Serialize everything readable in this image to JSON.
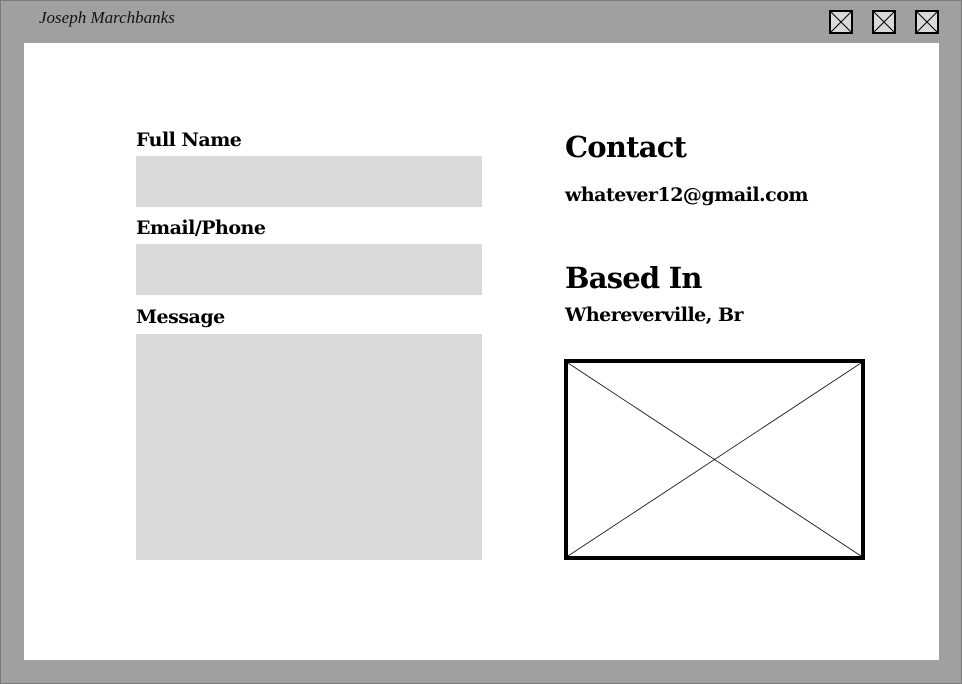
{
  "window": {
    "title": "Joseph Marchbanks",
    "buttons": [
      {
        "name": "minimize",
        "icon": "window-box-x-icon"
      },
      {
        "name": "maximize",
        "icon": "window-box-x-icon"
      },
      {
        "name": "close",
        "icon": "window-box-x-icon"
      }
    ]
  },
  "form": {
    "full_name_label": "Full Name",
    "full_name_value": "",
    "email_label": "Email/Phone",
    "email_value": "",
    "message_label": "Message",
    "message_value": ""
  },
  "contact": {
    "heading": "Contact",
    "email": "whatever12@gmail.com"
  },
  "location": {
    "heading": "Based In",
    "place": "Whereverville, Br"
  },
  "image": {
    "icon": "image-placeholder-icon"
  },
  "colors": {
    "frame": "#a0a0a0",
    "field": "#d9d9d9",
    "content": "#ffffff"
  }
}
